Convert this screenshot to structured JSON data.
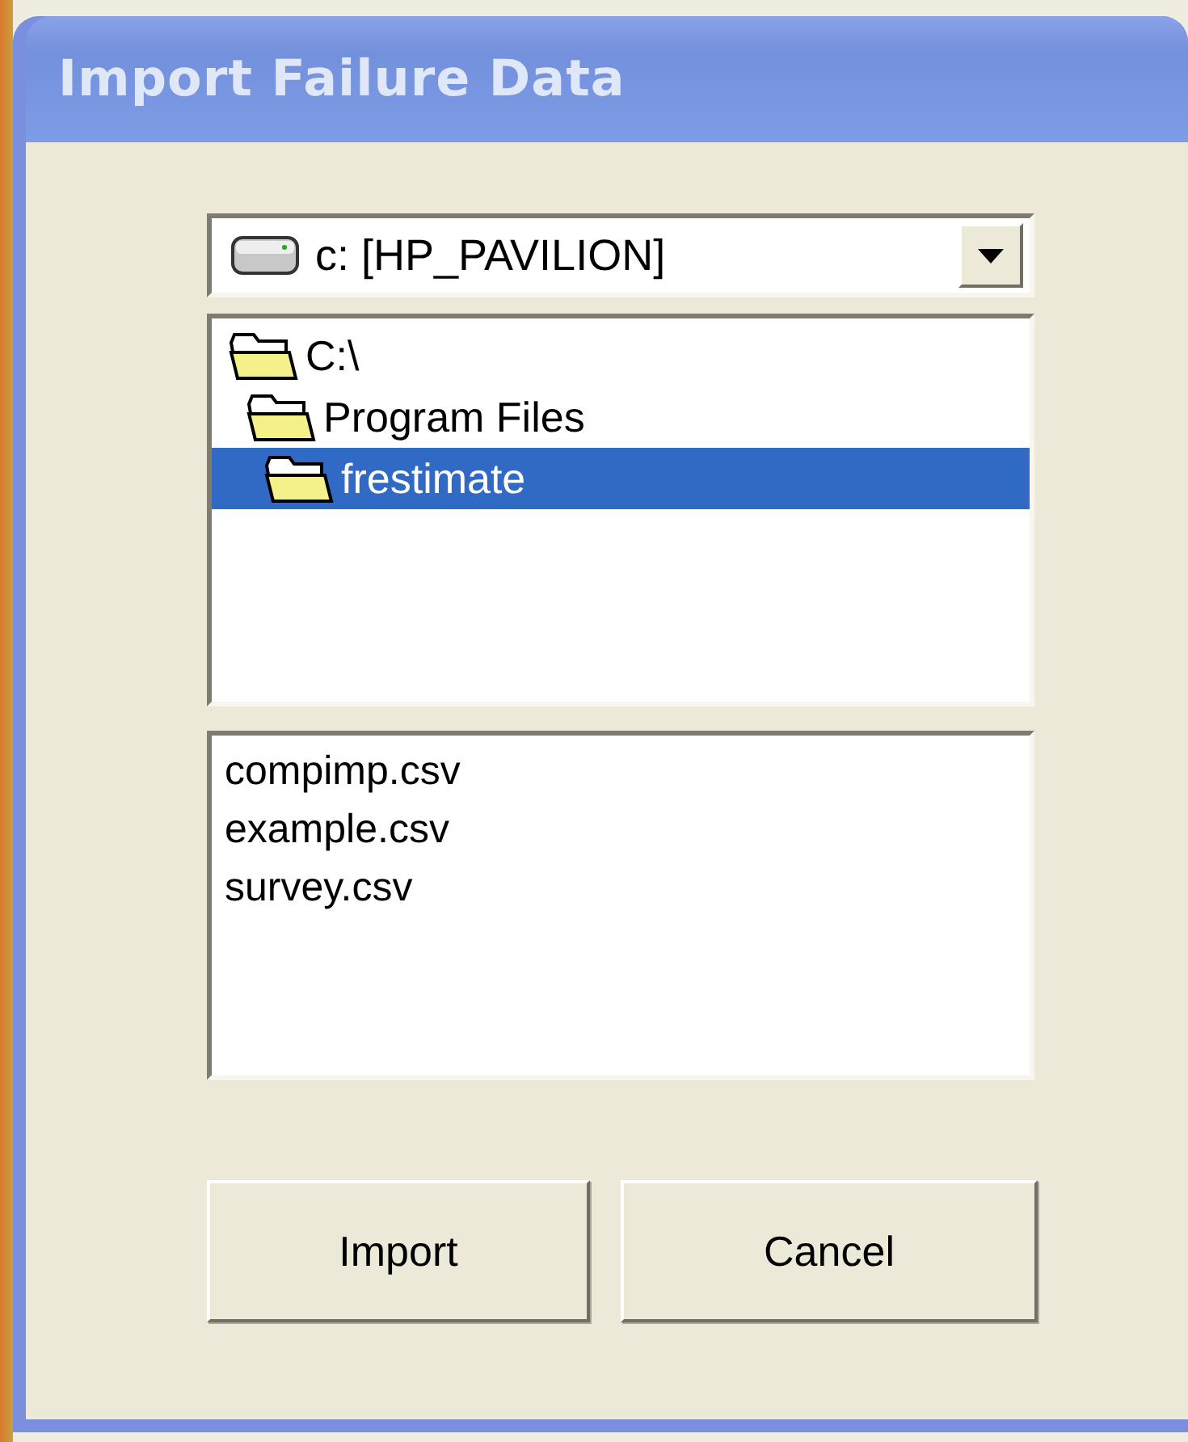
{
  "window": {
    "title": "Import Failure Data"
  },
  "drive_select": {
    "value": "c: [HP_PAVILION]"
  },
  "folders": [
    {
      "label": "C:\\",
      "selected": false,
      "children": [
        {
          "label": "Program Files",
          "selected": false,
          "children": [
            {
              "label": "frestimate",
              "selected": true
            }
          ]
        }
      ]
    }
  ],
  "files": [
    "compimp.csv",
    "example.csv",
    "survey.csv"
  ],
  "buttons": [
    "Import",
    "Cancel"
  ]
}
